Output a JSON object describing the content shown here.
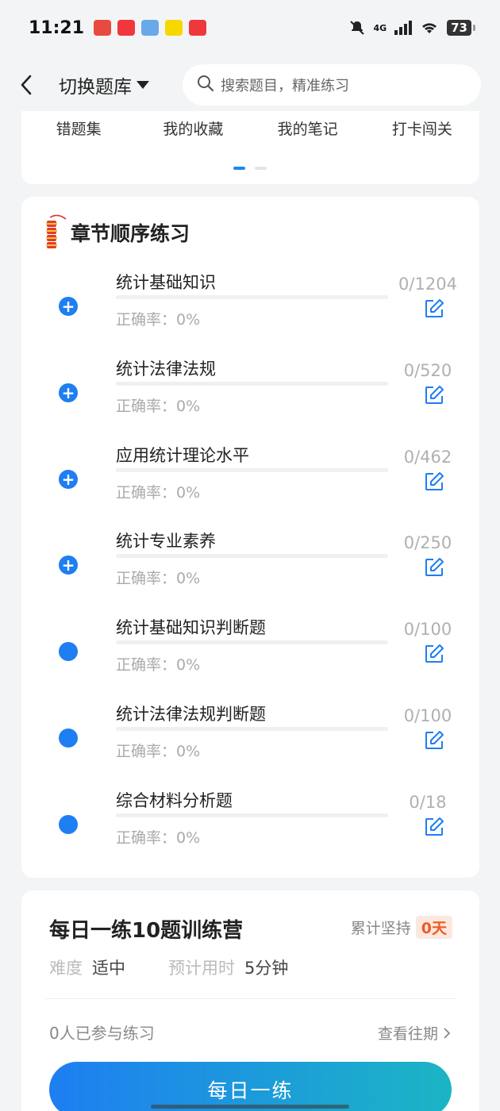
{
  "status_bar": {
    "time": "11:21",
    "network": "4G",
    "battery": "73"
  },
  "header": {
    "switch_label": "切换题库",
    "search_placeholder": "搜索题目，精准练习"
  },
  "quick_tabs": [
    "错题集",
    "我的收藏",
    "我的笔记",
    "打卡闯关"
  ],
  "chapters": {
    "title": "章节顺序练习",
    "accuracy_label": "正确率：",
    "items": [
      {
        "name": "统计基础知识",
        "count": "0/1204",
        "accuracy": "0%",
        "expandable": true,
        "progress": 0
      },
      {
        "name": "统计法律法规",
        "count": "0/520",
        "accuracy": "0%",
        "expandable": true,
        "progress": 0
      },
      {
        "name": "应用统计理论水平",
        "count": "0/462",
        "accuracy": "0%",
        "expandable": true,
        "progress": 0
      },
      {
        "name": "统计专业素养",
        "count": "0/250",
        "accuracy": "0%",
        "expandable": true,
        "progress": 0
      },
      {
        "name": "统计基础知识判断题",
        "count": "0/100",
        "accuracy": "0%",
        "expandable": false,
        "progress": 0
      },
      {
        "name": "统计法律法规判断题",
        "count": "0/100",
        "accuracy": "0%",
        "expandable": false,
        "progress": 0
      },
      {
        "name": "综合材料分析题",
        "count": "0/18",
        "accuracy": "0%",
        "expandable": false,
        "progress": 0
      }
    ]
  },
  "daily": {
    "title": "每日一练10题训练营",
    "persist_label": "累计坚持",
    "persist_days": "0天",
    "difficulty_label": "难度",
    "difficulty_value": "适中",
    "time_label": "预计用时",
    "time_value": "5分钟",
    "joined": "0人已参与练习",
    "history": "查看往期",
    "cta": "每日一练"
  },
  "colors": {
    "accent": "#1e7ef2",
    "cta_gradient_end": "#1bb5c4",
    "badge": "#f05a24"
  }
}
